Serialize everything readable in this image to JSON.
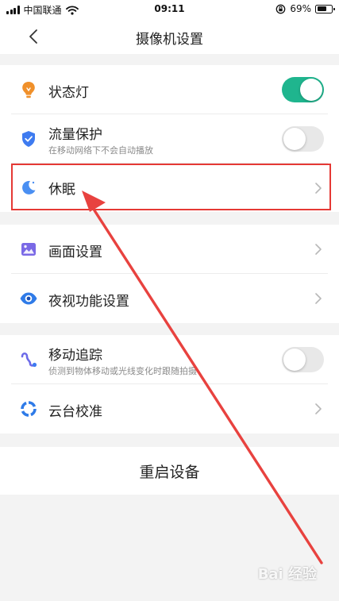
{
  "status_bar": {
    "carrier": "中国联通",
    "time": "09:11",
    "battery_pct": "69%",
    "battery_level": 0.69,
    "icons": [
      "signal-icon",
      "wifi-icon",
      "orientation-lock-icon",
      "battery-icon"
    ]
  },
  "header": {
    "title": "摄像机设置",
    "back_icon": "chevron-left-icon"
  },
  "groups": {
    "basic": {
      "status_light": {
        "label": "状态灯",
        "icon": "lightbulb-icon",
        "enabled": true
      },
      "data_protection": {
        "label": "流量保护",
        "sub": "在移动网络下不会自动播放",
        "icon": "shield-check-icon",
        "enabled": false
      },
      "sleep": {
        "label": "休眠",
        "icon": "moon-icon"
      }
    },
    "display": {
      "picture_settings": {
        "label": "画面设置",
        "icon": "image-icon"
      },
      "night_vision": {
        "label": "夜视功能设置",
        "icon": "eye-icon"
      }
    },
    "motion": {
      "motion_tracking": {
        "label": "移动追踪",
        "sub": "侦测到物体移动或光线变化时跟随拍摄",
        "icon": "path-icon",
        "enabled": false
      },
      "ptz_calibration": {
        "label": "云台校准",
        "icon": "calibration-ring-icon"
      }
    }
  },
  "restart_label": "重启设备",
  "annotation": {
    "highlight_color": "#e53935",
    "arrow_color": "#e8423f"
  },
  "watermark": "Bai 经验",
  "colors": {
    "toggle_on": "#1fb58e",
    "toggle_off": "#e8e8e8",
    "bulb": "#f0902a",
    "accent_blue": "#3e7bf0",
    "purple": "#7a69e6"
  }
}
